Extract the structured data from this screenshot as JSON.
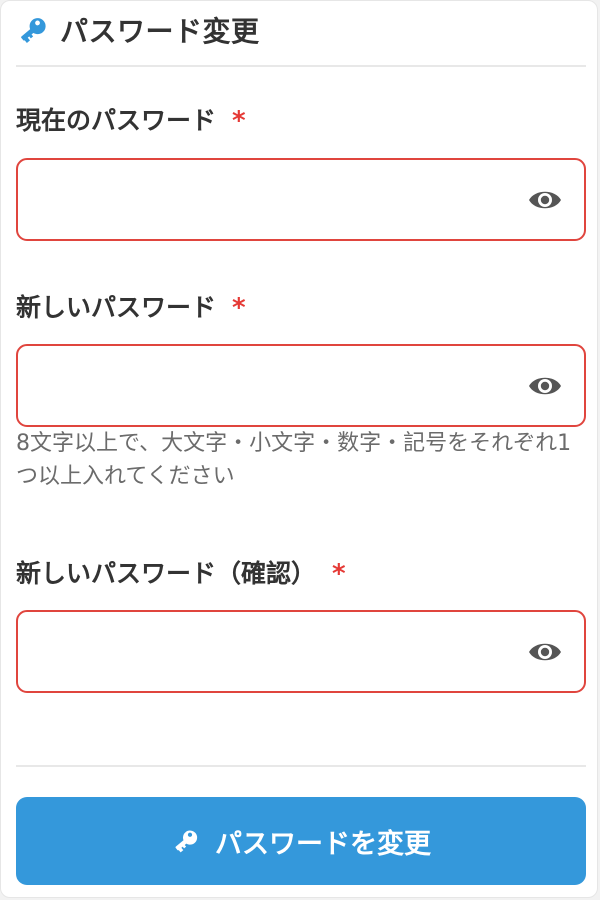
{
  "header": {
    "title": "パスワード変更",
    "icon": "key-icon",
    "icon_color": "#3498db"
  },
  "fields": [
    {
      "label": "現在のパスワード",
      "required_mark": "*",
      "value": "",
      "toggle_icon": "eye-icon"
    },
    {
      "label": "新しいパスワード",
      "required_mark": "*",
      "value": "",
      "toggle_icon": "eye-icon",
      "hint": "8文字以上で、大文字・小文字・数字・記号をそれぞれ1つ以上入れてください"
    },
    {
      "label": "新しいパスワード（確認）",
      "required_mark": "*",
      "value": "",
      "toggle_icon": "eye-icon"
    }
  ],
  "submit": {
    "label": "パスワードを変更",
    "icon": "key-icon",
    "color": "#3498db"
  },
  "colors": {
    "error_border": "#e0453e",
    "required": "#e53935",
    "text": "#333333",
    "hint": "#6b6b6b"
  }
}
